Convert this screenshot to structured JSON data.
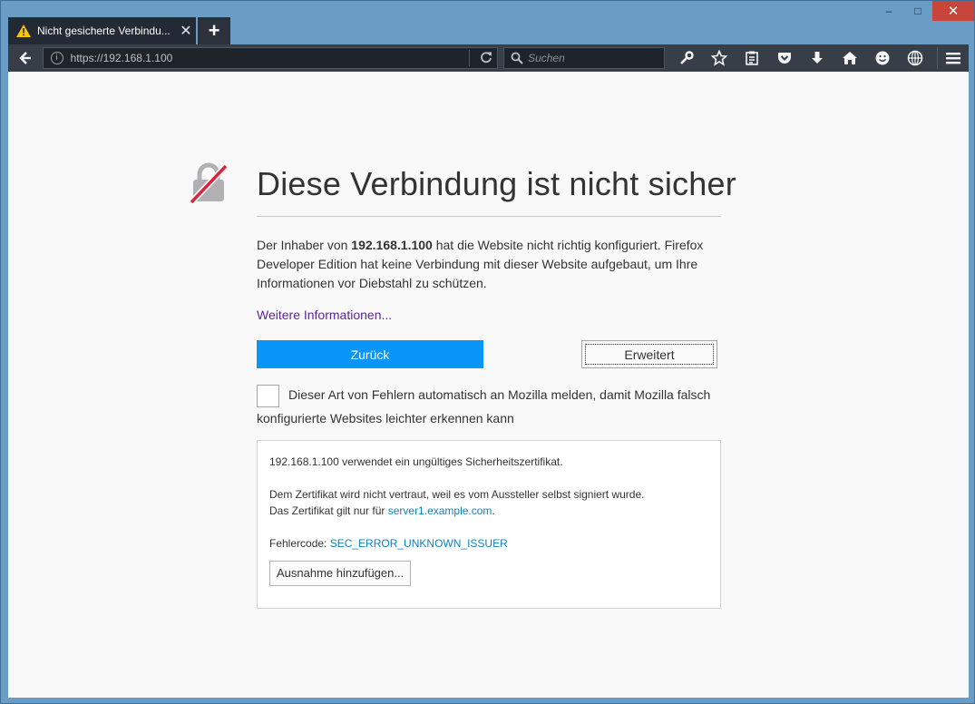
{
  "window": {
    "minimize": "–",
    "maximize": "□",
    "close": "✕"
  },
  "tab": {
    "title": "Nicht gesicherte Verbindu...",
    "close_label": "✕",
    "new_tab_label": "+"
  },
  "navbar": {
    "url": "https://192.168.1.100",
    "search_placeholder": "Suchen"
  },
  "page": {
    "heading": "Diese Verbindung ist nicht sicher",
    "desc_prefix": "Der Inhaber von ",
    "desc_host": "192.168.1.100",
    "desc_suffix": " hat die Website nicht richtig konfiguriert. Firefox Developer Edition hat keine Verbindung mit dieser Website aufgebaut, um Ihre Informationen vor Diebstahl zu schützen.",
    "more_info": "Weitere Informationen...",
    "back_button": "Zurück",
    "advanced_button": "Erweitert",
    "report_text": "Dieser Art von Fehlern automatisch an Mozilla melden, damit Mozilla falsch konfigurierte Websites leichter erkennen kann"
  },
  "details": {
    "line1": "192.168.1.100 verwendet ein ungültiges Sicherheitszertifikat.",
    "line2": "Dem Zertifikat wird nicht vertraut, weil es vom Aussteller selbst signiert wurde.",
    "line3_prefix": "Das Zertifikat gilt nur für ",
    "line3_link": "server1.example.com",
    "line3_suffix": ".",
    "error_label": "Fehlercode: ",
    "error_code": "SEC_ERROR_UNKNOWN_ISSUER",
    "add_exception": "Ausnahme hinzufügen..."
  },
  "colors": {
    "accent": "#0996f8",
    "link": "#0a84bd",
    "visited_link": "#5c2699",
    "lock_slash": "#d7263d"
  }
}
